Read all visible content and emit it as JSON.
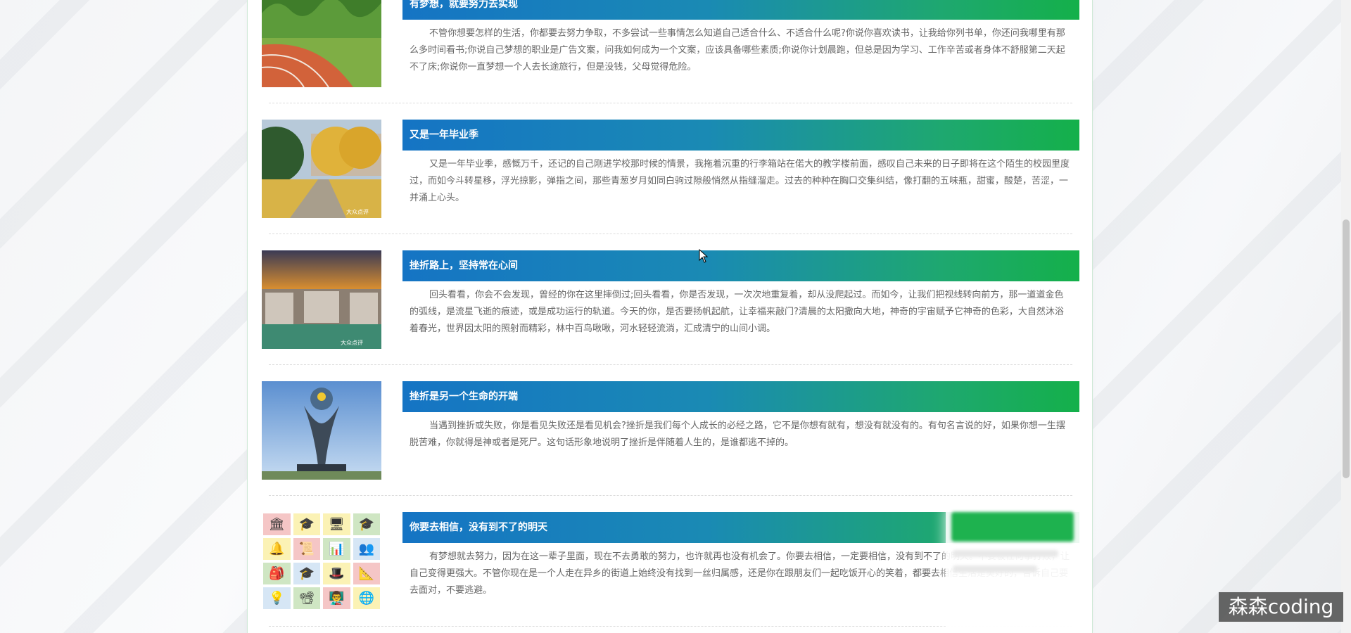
{
  "articles": [
    {
      "title": "有梦想，就要努力去实现",
      "body": "不管你想要怎样的生活，你都要去努力争取，不多尝试一些事情怎么知道自己适合什么、不适合什么呢?你说你喜欢读书，让我给你列书单，你还问我哪里有那么多时间看书;你说自己梦想的职业是广告文案，问我如何成为一个文案，应该具备哪些素质;你说你计划晨跑，但总是因为学习、工作辛苦或者身体不舒服第二天起不了床;你说你一直梦想一个人去长途旅行，但是没钱，父母觉得危险。"
    },
    {
      "title": "又是一年毕业季",
      "body": "又是一年毕业季，感慨万千，还记的自己刚进学校那时候的情景，我拖着沉重的行李箱站在偌大的教学楼前面，感叹自己未来的日子即将在这个陌生的校园里度过，而如今斗转星移，浮光掠影，弹指之间，那些青葱岁月如同白驹过隙般悄然从指缝溜走。过去的种种在胸口交集纠结，像打翻的五味瓶，甜蜜，酸楚，苦涩，一并涌上心头。"
    },
    {
      "title": "挫折路上，坚持常在心间",
      "body": "回头看看，你会不会发现，曾经的你在这里摔倒过;回头看看，你是否发现，一次次地重复着，却从没爬起过。而如今，让我们把视线转向前方，那一道道金色的弧线，是流星飞逝的痕迹，或是成功运行的轨道。今天的你，是否要扬帆起航，让幸福来敲门?清晨的太阳撒向大地，神奇的宇宙赋予它神奇的色彩，大自然沐浴着春光，世界因太阳的照射而精彩，林中百鸟啾啾，河水轻轻流淌，汇成清宁的山间小调。"
    },
    {
      "title": "挫折是另一个生命的开端",
      "body": "当遇到挫折或失败，你是看见失败还是看见机会?挫折是我们每个人成长的必经之路，它不是你想有就有，想没有就没有的。有句名言说的好，如果你想一生摆脱苦难，你就得是神或者是死尸。这句话形象地说明了挫折是伴随着人生的，是谁都逃不掉的。"
    },
    {
      "title": "你要去相信，没有到不了的明天",
      "body": "有梦想就去努力，因为在这一辈子里面，现在不去勇敢的努力，也许就再也没有机会了。你要去相信，一定要相信，没有到不了的明天。不要被任何事打败，让自己变得更强大。不管你现在是一个人走在异乡的街道上始终没有找到一丝归属感，还是你在跟朋友们一起吃饭开心的笑着，都要去相信生活是美好的，告诉自己要去面对，不要逃避。"
    }
  ],
  "photo_marks": [
    "大众点评",
    "大众点评"
  ],
  "icon_tiles": [
    {
      "icon": "bank-icon",
      "glyph": "🏛",
      "color": "#f5c6c6"
    },
    {
      "icon": "graduation-cap-icon",
      "glyph": "🎓",
      "color": "#fbf2b5"
    },
    {
      "icon": "presentation-icon",
      "glyph": "🖥",
      "color": "#fbf2b5"
    },
    {
      "icon": "graduate-icon",
      "glyph": "🎓",
      "color": "#cfe6c3"
    },
    {
      "icon": "bell-icon",
      "glyph": "🔔",
      "color": "#fbf2b5"
    },
    {
      "icon": "certificate-icon",
      "glyph": "📜",
      "color": "#f5c6c6"
    },
    {
      "icon": "chart-icon",
      "glyph": "📊",
      "color": "#cfe6c3"
    },
    {
      "icon": "students-icon",
      "glyph": "👥",
      "color": "#d6e6f5"
    },
    {
      "icon": "school-bag-icon",
      "glyph": "🎒",
      "color": "#cfe6c3"
    },
    {
      "icon": "cap-icon",
      "glyph": "🎓",
      "color": "#d6e6f5"
    },
    {
      "icon": "hat-icon",
      "glyph": "🎩",
      "color": "#fbf2b5"
    },
    {
      "icon": "compass-icon",
      "glyph": "📐",
      "color": "#f5c6c6"
    },
    {
      "icon": "lamp-icon",
      "glyph": "💡",
      "color": "#d6e6f5"
    },
    {
      "icon": "projector-icon",
      "glyph": "📽",
      "color": "#cfe6c3"
    },
    {
      "icon": "teacher-icon",
      "glyph": "👨‍🏫",
      "color": "#f5c6c6"
    },
    {
      "icon": "globe-icon",
      "glyph": "🌐",
      "color": "#fbf2b5"
    }
  ],
  "watermark": "森森coding"
}
